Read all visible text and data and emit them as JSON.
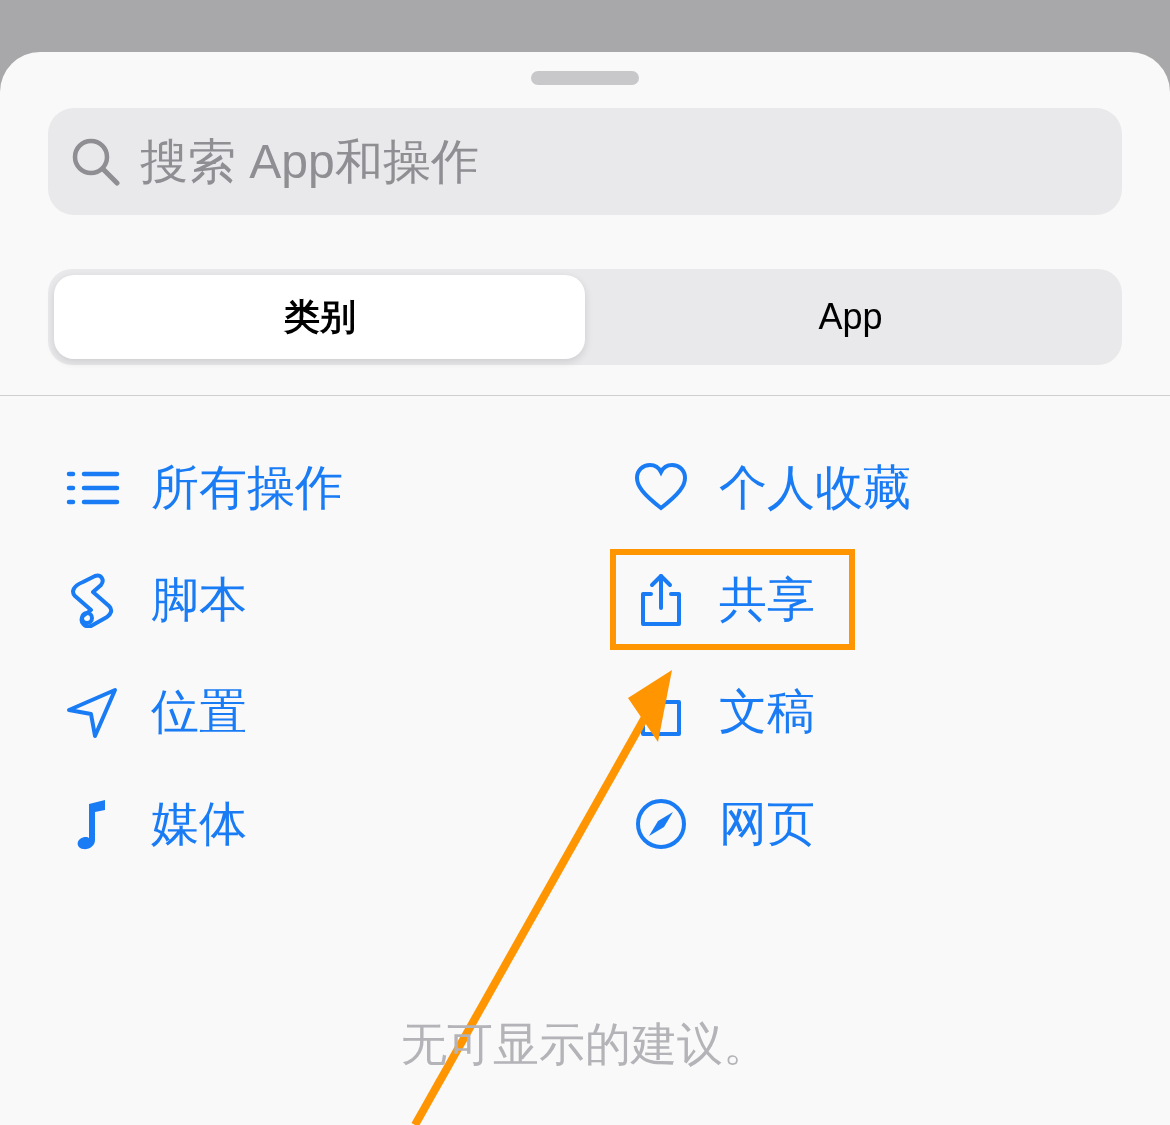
{
  "search": {
    "placeholder": "搜索 App和操作"
  },
  "segments": [
    {
      "label": "类别",
      "selected": true
    },
    {
      "label": "App",
      "selected": false
    }
  ],
  "categories": [
    {
      "kind": "list",
      "label": "所有操作",
      "highlighted": false
    },
    {
      "kind": "favorites",
      "label": "个人收藏",
      "highlighted": false
    },
    {
      "kind": "script",
      "label": "脚本",
      "highlighted": false
    },
    {
      "kind": "share",
      "label": "共享",
      "highlighted": true
    },
    {
      "kind": "location",
      "label": "位置",
      "highlighted": false
    },
    {
      "kind": "documents",
      "label": "文稿",
      "highlighted": false
    },
    {
      "kind": "media",
      "label": "媒体",
      "highlighted": false
    },
    {
      "kind": "web",
      "label": "网页",
      "highlighted": false
    }
  ],
  "empty_message": "无可显示的建议。"
}
